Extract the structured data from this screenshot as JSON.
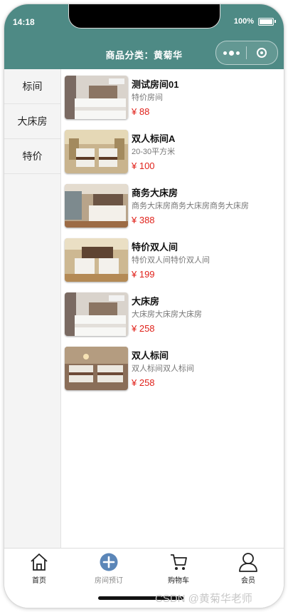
{
  "status_bar": {
    "time": "14:18",
    "battery": "100%"
  },
  "header": {
    "title": "商品分类：黄菊华"
  },
  "sidebar": {
    "items": [
      {
        "label": "标间"
      },
      {
        "label": "大床房"
      },
      {
        "label": "特价"
      }
    ]
  },
  "rooms": [
    {
      "name": "测试房间01",
      "desc": "特价房间",
      "price": "¥ 88"
    },
    {
      "name": "双人标间A",
      "desc": "20-30平方米",
      "price": "¥ 100"
    },
    {
      "name": "商务大床房",
      "desc": "商务大床房商务大床房商务大床房",
      "price": "¥ 388"
    },
    {
      "name": "特价双人间",
      "desc": "特价双人间特价双人间",
      "price": "¥ 199"
    },
    {
      "name": "大床房",
      "desc": "大床房大床房大床房",
      "price": "¥ 258"
    },
    {
      "name": "双人标间",
      "desc": "双人标间双人标间",
      "price": "¥ 258"
    }
  ],
  "tabbar": {
    "items": [
      {
        "label": "首页",
        "icon": "home-icon"
      },
      {
        "label": "房间预订",
        "icon": "plus-circle-icon",
        "color": "#5b86b8"
      },
      {
        "label": "购物车",
        "icon": "cart-icon"
      },
      {
        "label": "会员",
        "icon": "user-icon"
      }
    ]
  },
  "watermark": "CSDN @黄菊华老师",
  "colors": {
    "header": "#4e8a85",
    "price": "#e0221b"
  }
}
